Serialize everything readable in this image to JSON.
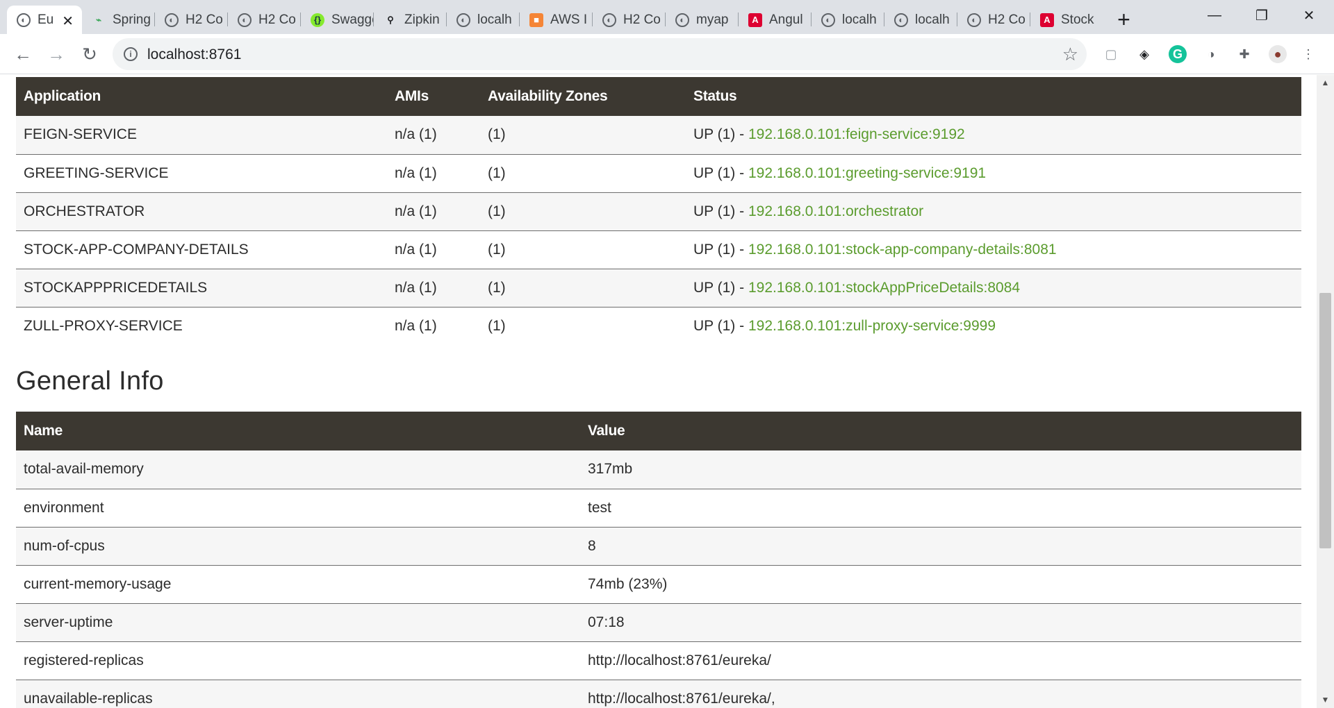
{
  "browser": {
    "tabs": [
      {
        "label": "Eu",
        "icon": "globe-icon",
        "active": true
      },
      {
        "label": "Spring",
        "icon": "spring-pulse-icon"
      },
      {
        "label": "H2 Co",
        "icon": "globe-icon"
      },
      {
        "label": "H2 Co",
        "icon": "globe-icon"
      },
      {
        "label": "Swagger",
        "icon": "swagger-icon"
      },
      {
        "label": "Zipkin",
        "icon": "zipkin-icon"
      },
      {
        "label": "localh",
        "icon": "globe-icon"
      },
      {
        "label": "AWS I",
        "icon": "aws-cube-icon"
      },
      {
        "label": "H2 Co",
        "icon": "globe-icon"
      },
      {
        "label": "myap",
        "icon": "globe-icon"
      },
      {
        "label": "Angul",
        "icon": "angular-icon"
      },
      {
        "label": "localh",
        "icon": "globe-icon"
      },
      {
        "label": "localh",
        "icon": "globe-icon"
      },
      {
        "label": "H2 Co",
        "icon": "globe-icon"
      },
      {
        "label": "Stock",
        "icon": "angular-icon"
      }
    ],
    "url": "localhost:8761"
  },
  "applications": {
    "headers": [
      "Application",
      "AMIs",
      "Availability Zones",
      "Status"
    ],
    "rows": [
      {
        "name": "FEIGN-SERVICE",
        "amis": "n/a (1)",
        "zones": "(1)",
        "status": "UP (1) - ",
        "link": "192.168.0.101:feign-service:9192"
      },
      {
        "name": "GREETING-SERVICE",
        "amis": "n/a (1)",
        "zones": "(1)",
        "status": "UP (1) - ",
        "link": "192.168.0.101:greeting-service:9191"
      },
      {
        "name": "ORCHESTRATOR",
        "amis": "n/a (1)",
        "zones": "(1)",
        "status": "UP (1) - ",
        "link": "192.168.0.101:orchestrator"
      },
      {
        "name": "STOCK-APP-COMPANY-DETAILS",
        "amis": "n/a (1)",
        "zones": "(1)",
        "status": "UP (1) - ",
        "link": "192.168.0.101:stock-app-company-details:8081"
      },
      {
        "name": "STOCKAPPPRICEDETAILS",
        "amis": "n/a (1)",
        "zones": "(1)",
        "status": "UP (1) - ",
        "link": "192.168.0.101:stockAppPriceDetails:8084"
      },
      {
        "name": "ZULL-PROXY-SERVICE",
        "amis": "n/a (1)",
        "zones": "(1)",
        "status": "UP (1) - ",
        "link": "192.168.0.101:zull-proxy-service:9999"
      }
    ]
  },
  "general_info": {
    "title": "General Info",
    "headers": [
      "Name",
      "Value"
    ],
    "rows": [
      {
        "name": "total-avail-memory",
        "value": "317mb"
      },
      {
        "name": "environment",
        "value": "test"
      },
      {
        "name": "num-of-cpus",
        "value": "8"
      },
      {
        "name": "current-memory-usage",
        "value": "74mb (23%)"
      },
      {
        "name": "server-uptime",
        "value": "07:18"
      },
      {
        "name": "registered-replicas",
        "value": "http://localhost:8761/eureka/"
      },
      {
        "name": "unavailable-replicas",
        "value": "http://localhost:8761/eureka/,"
      }
    ]
  },
  "colors": {
    "header_bg": "#3c3831",
    "link": "#5b9c2e"
  }
}
